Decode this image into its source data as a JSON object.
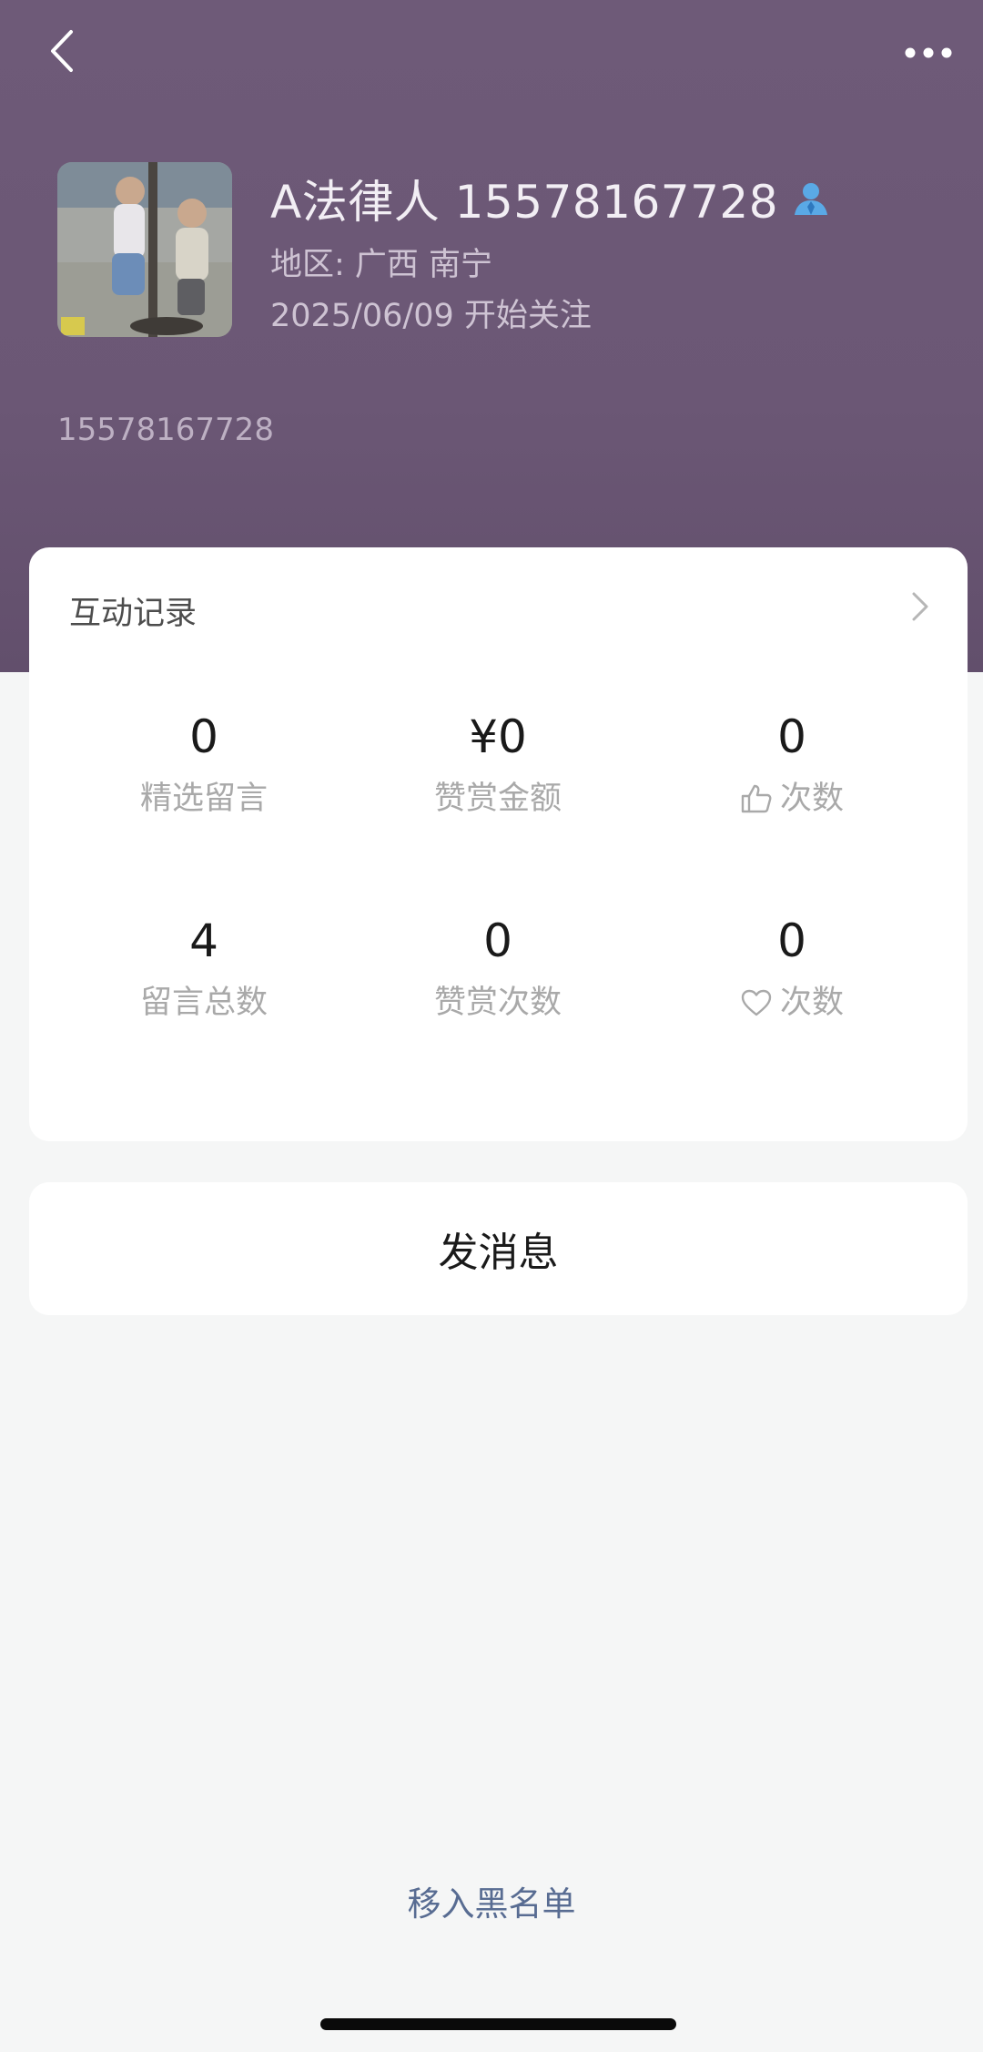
{
  "profile": {
    "name": "A法律人 15578167728",
    "region": "地区: 广西 南宁",
    "follow_date": "2025/06/09 开始关注",
    "signature": "15578167728"
  },
  "stats": {
    "section_title": "互动记录",
    "items": [
      {
        "value": "0",
        "label": "精选留言",
        "icon": null
      },
      {
        "value": "¥0",
        "label": "赞赏金额",
        "icon": null
      },
      {
        "value": "0",
        "label": "次数",
        "icon": "thumbs-up-icon"
      },
      {
        "value": "4",
        "label": "留言总数",
        "icon": null
      },
      {
        "value": "0",
        "label": "赞赏次数",
        "icon": null
      },
      {
        "value": "0",
        "label": "次数",
        "icon": "heart-icon"
      }
    ]
  },
  "actions": {
    "send_message": "发消息",
    "blacklist": "移入黑名单"
  },
  "colors": {
    "header_bg": "#6B5775",
    "link": "#586C92",
    "page_bg": "#F5F6F6"
  }
}
